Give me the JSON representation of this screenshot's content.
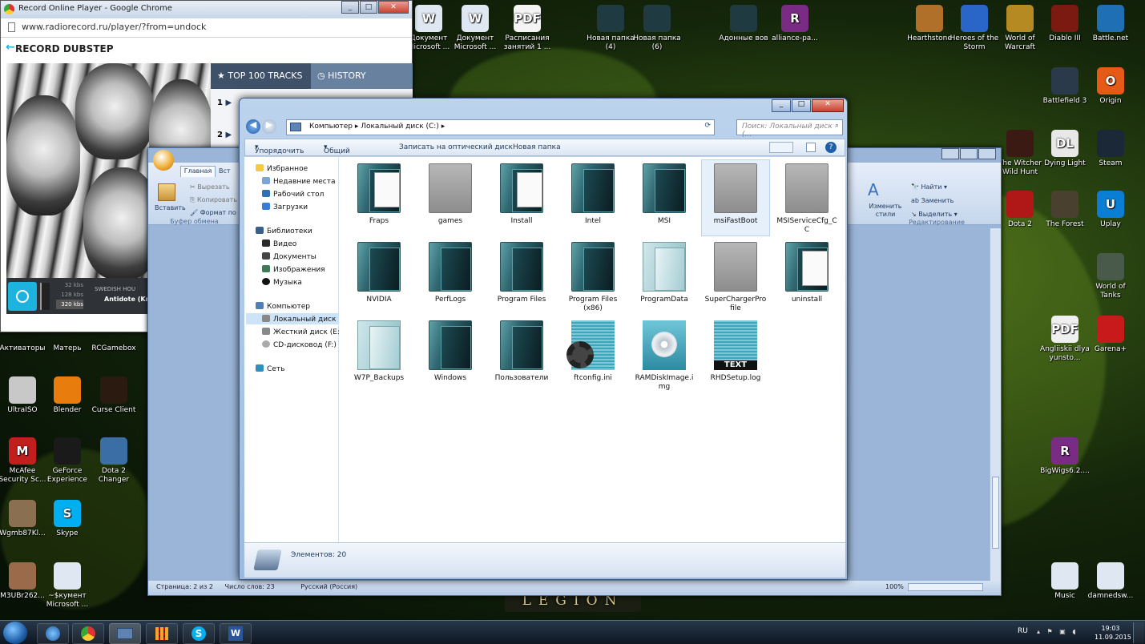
{
  "colors": {
    "accent": "#1cb4de",
    "explorer_frame": "#9db9dc",
    "taskbar": "#0e1722",
    "close": "#c84030"
  },
  "wallpaper": {
    "logo_text": "LEGION"
  },
  "desktop": {
    "top_row": [
      {
        "label": "Документ Microsoft ...",
        "icon": "word-doc-icon"
      },
      {
        "label": "Документ Microsoft ...",
        "icon": "word-doc-icon"
      },
      {
        "label": "Расписания занятий 1 ...",
        "icon": "pdf-icon"
      },
      {
        "label": "Новая папка (4)",
        "icon": "folder-icon"
      },
      {
        "label": "Новая папка (6)",
        "icon": "folder-icon"
      },
      {
        "label": "Адонные вов",
        "icon": "folder-icon"
      },
      {
        "label": "alliance-pa...",
        "icon": "winrar-icon"
      }
    ],
    "right_top": [
      {
        "label": "Hearthstone",
        "icon": "hearthstone-icon"
      },
      {
        "label": "Heroes of the Storm",
        "icon": "heroes-icon"
      },
      {
        "label": "World of Warcraft",
        "icon": "wow-icon"
      },
      {
        "label": "Diablo III",
        "icon": "diablo-icon"
      },
      {
        "label": "Battle.net",
        "icon": "battlenet-icon"
      }
    ],
    "right_col": [
      {
        "label": "Battlefield 3",
        "icon": "battlefield-icon"
      },
      {
        "label": "Origin",
        "icon": "origin-icon"
      },
      {
        "label": "The Witcher Wild Hunt",
        "icon": "witcher-icon"
      },
      {
        "label": "Dying Light",
        "icon": "dyinglight-icon"
      },
      {
        "label": "Steam",
        "icon": "steam-icon"
      },
      {
        "label": "Dota 2",
        "icon": "dota-icon"
      },
      {
        "label": "The Forest",
        "icon": "forest-icon"
      },
      {
        "label": "Uplay",
        "icon": "uplay-icon"
      },
      {
        "label": "World of Tanks",
        "icon": "wot-icon"
      },
      {
        "label": "Angliiskii dlya yunsto...",
        "icon": "pdf-icon"
      },
      {
        "label": "Garena+",
        "icon": "garena-icon"
      },
      {
        "label": "BigWigs6.2....",
        "icon": "winrar-icon"
      },
      {
        "label": "Music",
        "icon": "folder-icon"
      },
      {
        "label": "damnedsw...",
        "icon": "word-doc-icon"
      }
    ],
    "left_col": [
      {
        "label": "Активаторы"
      },
      {
        "label": "Матерь"
      },
      {
        "label": "RCGamebox"
      },
      {
        "label": "UltraISO"
      },
      {
        "label": "Blender"
      },
      {
        "label": "Curse Client"
      },
      {
        "label": "McAfee Security Sc..."
      },
      {
        "label": "GeForce Experience"
      },
      {
        "label": "Dota 2 Changer"
      },
      {
        "label": "Wgmb87Kl..."
      },
      {
        "label": "Skype"
      },
      {
        "label": "M3UBr262..."
      },
      {
        "label": "~$кумент Microsoft ..."
      }
    ]
  },
  "chrome": {
    "title": "Record Online Player - Google Chrome",
    "url": "www.radiorecord.ru/player/?from=undock",
    "station": "RECORD DUBSTEP",
    "tab_top": "TOP 100 TRACKS",
    "tab_history": "HISTORY",
    "track_nums": [
      "1",
      "2"
    ],
    "bitrates": [
      "32 kbs",
      "128 kbs",
      "320 kbs"
    ],
    "artist": "SWEDISH HOU",
    "track": "Antidote (Kn"
  },
  "word": {
    "tabs": [
      "Главная",
      "Вст"
    ],
    "clipboard": {
      "paste": "Вставить",
      "cut": "Вырезать",
      "copy": "Копировать",
      "format": "Формат по о",
      "group": "Буфер обмена"
    },
    "editing": {
      "find": "Найти",
      "replace": "Заменить",
      "select": "Выделить",
      "styles": "Изменить стили",
      "group": "Редактирование"
    },
    "status": {
      "page": "Страница: 2 из 2",
      "words": "Число слов: 23",
      "lang": "Русский (Россия)",
      "zoom": "100%"
    }
  },
  "explorer": {
    "breadcrumb": [
      "Компьютер",
      "Локальный диск (C:)"
    ],
    "search_placeholder": "Поиск: Локальный диск (...",
    "toolbar": [
      "Упорядочить",
      "Общий доступ",
      "Записать на оптический диск",
      "Новая папка"
    ],
    "nav": {
      "favorites": "Избранное",
      "fav_items": [
        "Недавние места",
        "Рабочий стол",
        "Загрузки"
      ],
      "libraries": "Библиотеки",
      "lib_items": [
        "Видео",
        "Документы",
        "Изображения",
        "Музыка"
      ],
      "computer": "Компьютер",
      "comp_items": [
        "Локальный диск (C",
        "Жесткий диск (E:)",
        "CD-дисковод (F:)"
      ],
      "network": "Сеть"
    },
    "files": [
      {
        "name": "Fraps",
        "kind": "folder withdoc"
      },
      {
        "name": "games",
        "kind": "empty"
      },
      {
        "name": "Install",
        "kind": "folder withdoc"
      },
      {
        "name": "Intel",
        "kind": "folder"
      },
      {
        "name": "MSI",
        "kind": "folder"
      },
      {
        "name": "msiFastBoot",
        "kind": "empty sel"
      },
      {
        "name": "MSIServiceCfg_C C",
        "kind": "empty"
      },
      {
        "name": "NVIDIA",
        "kind": "folder"
      },
      {
        "name": "PerfLogs",
        "kind": "folder"
      },
      {
        "name": "Program Files",
        "kind": "folder"
      },
      {
        "name": "Program Files (x86)",
        "kind": "folder"
      },
      {
        "name": "ProgramData",
        "kind": "light"
      },
      {
        "name": "SuperChargerPro file",
        "kind": "empty"
      },
      {
        "name": "uninstall",
        "kind": "folder withdoc"
      },
      {
        "name": "W7P_Backups",
        "kind": "light"
      },
      {
        "name": "Windows",
        "kind": "folder"
      },
      {
        "name": "Пользователи",
        "kind": "folder"
      },
      {
        "name": "ftconfig.ini",
        "kind": "cfg"
      },
      {
        "name": "RAMDiskImage.i mg",
        "kind": "img"
      },
      {
        "name": "RHDSetup.log",
        "kind": "log"
      }
    ],
    "file_badge_text": "TEXT",
    "status": "Элементов: 20"
  },
  "tray": {
    "lang": "RU",
    "time": "19:03",
    "date": "11.09.2015"
  }
}
